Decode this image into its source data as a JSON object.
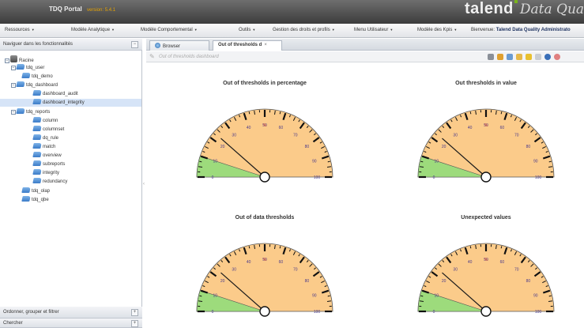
{
  "app": {
    "title": "TDQ Portal",
    "version": "version: 5.4.1"
  },
  "brand": {
    "name": "talend",
    "product": "Data Qualit"
  },
  "menu": {
    "items": [
      {
        "label": "Ressources"
      },
      {
        "label": "Modèle Analytique"
      },
      {
        "label": "Modèle Comportemental"
      },
      {
        "label": "Outils"
      },
      {
        "label": "Gestion des droits et profils"
      },
      {
        "label": "Menu Utilisateur"
      },
      {
        "label": "Modèle des Kpis"
      }
    ],
    "welcome_prefix": "Bienvenue:",
    "welcome_user": "Talend Data Quality Administrato"
  },
  "left_panel": {
    "title": "Naviguer dans les fonctionnalités",
    "collapse": "−",
    "bottom_sections": [
      {
        "label": "Ordonner, grouper et filtrer",
        "btn": "+"
      },
      {
        "label": "Chercher",
        "btn": "+"
      }
    ]
  },
  "tree": [
    {
      "label": "Racine",
      "toggle": "−",
      "root": true
    },
    {
      "label": "tdq_user",
      "toggle": "−"
    },
    {
      "label": "tdq_demo"
    },
    {
      "label": "tdq_dashboard",
      "toggle": "−"
    },
    {
      "label": "dashboard_audit"
    },
    {
      "label": "dashboard_integrity",
      "selected": true
    },
    {
      "label": "tdq_reports",
      "toggle": "−"
    },
    {
      "label": "column"
    },
    {
      "label": "columnset"
    },
    {
      "label": "dq_rule"
    },
    {
      "label": "match"
    },
    {
      "label": "overview"
    },
    {
      "label": "subreports"
    },
    {
      "label": "integrity"
    },
    {
      "label": "redundancy"
    },
    {
      "label": "tdq_olap"
    },
    {
      "label": "tdq_qbe"
    }
  ],
  "tabs": [
    {
      "label": "Browser",
      "active": false
    },
    {
      "label": "Out of thresholds d",
      "active": true,
      "close": "×"
    }
  ],
  "breadcrumb": "Out of thresholds dashboard",
  "toolbar_icons": [
    {
      "name": "print-icon",
      "color": "#8a8f98"
    },
    {
      "name": "refresh-icon",
      "color": "#e0a030"
    },
    {
      "name": "export-icon",
      "color": "#6a9bd2"
    },
    {
      "name": "folder-icon",
      "color": "#e6b84a"
    },
    {
      "name": "star-icon",
      "color": "#e8c030"
    },
    {
      "name": "page-icon",
      "color": "#c9cdd3"
    },
    {
      "name": "help-icon",
      "color": "#3a6fb8"
    },
    {
      "name": "close-icon",
      "color": "#e08080"
    }
  ],
  "gauges": [
    {
      "title": "Out of thresholds in percentage",
      "value": 23
    },
    {
      "title": "Out thresholds in value",
      "value": 23
    },
    {
      "title": "Out of data thresholds",
      "value": 23
    },
    {
      "title": "Unexpected values",
      "value": 23
    }
  ],
  "gauge_scale": {
    "unit": "%",
    "labels": [
      "0",
      "10",
      "20",
      "30",
      "40",
      "50",
      "60",
      "70",
      "80",
      "90",
      "100"
    ],
    "green_limit": 10,
    "colors": {
      "main": "#fbcb8a",
      "green": "#9ddb7c",
      "ticks": "#111111",
      "labels": "#4a3a8c",
      "needle": "#1a1a1a"
    }
  }
}
